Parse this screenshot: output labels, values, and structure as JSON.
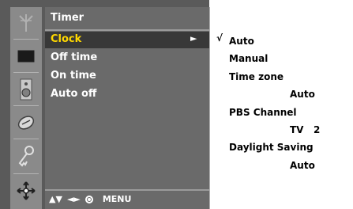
{
  "icons": [
    {
      "name": "antenna-icon"
    },
    {
      "name": "screen-icon"
    },
    {
      "name": "speaker-icon"
    },
    {
      "name": "clock-icon"
    },
    {
      "name": "key-icon"
    },
    {
      "name": "setup-icon"
    }
  ],
  "menu": {
    "title": "Timer",
    "items": [
      {
        "label": "Clock",
        "selected": true,
        "arrow": "►"
      },
      {
        "label": "Off time"
      },
      {
        "label": "On time"
      },
      {
        "label": "Auto off"
      }
    ]
  },
  "nav": {
    "updown": "▲▼",
    "leftright": "◄►",
    "menu_label": "MENU"
  },
  "submenu": {
    "check": "√",
    "auto": "Auto",
    "manual": "Manual",
    "time_zone": "Time zone",
    "time_zone_value": "Auto",
    "pbs_channel": "PBS Channel",
    "pbs_channel_value": "TV   2",
    "daylight_saving": "Daylight Saving",
    "daylight_saving_value": "Auto"
  },
  "colors": {
    "frame": "#5a5a5a",
    "icon_column": "#8a8a8a",
    "list_panel": "#6a6a6a",
    "selected_bg": "#383838",
    "selected_text": "#ffd800"
  }
}
